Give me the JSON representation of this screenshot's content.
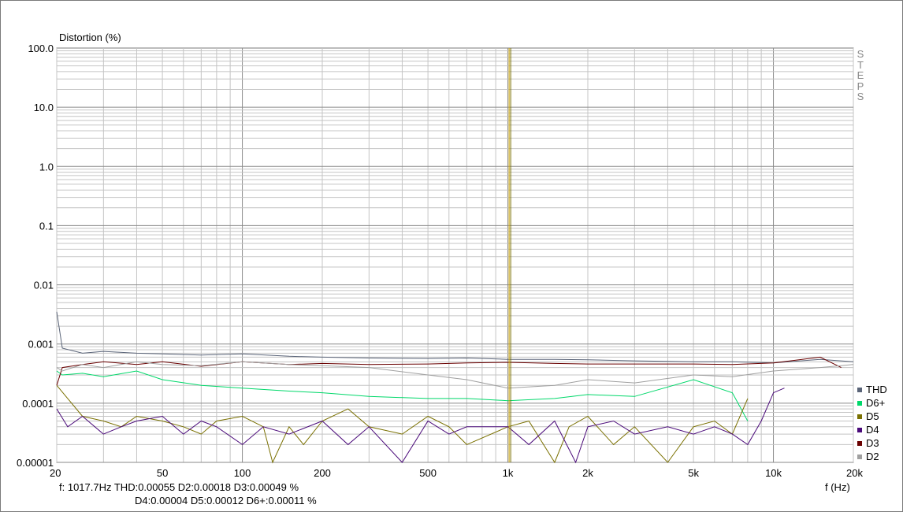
{
  "window": {
    "ylabel": "Distortion (%)",
    "xlabel": "f (Hz)",
    "steps_label": "STEPS"
  },
  "readout": {
    "line1": "f:  1017.7Hz      THD:0.00055   D2:0.00018   D3:0.00049 %",
    "line2": "D4:0.00004   D5:0.00012   D6+:0.00011 %"
  },
  "chart_data": {
    "type": "line",
    "title": "",
    "xlabel": "f (Hz)",
    "ylabel": "Distortion (%)",
    "xscale": "log",
    "yscale": "log",
    "xlim": [
      20,
      20000
    ],
    "ylim": [
      1e-05,
      100
    ],
    "grid": true,
    "legend_position": "bottom-right",
    "marker_frequency": 1017.7,
    "x_ticks": [
      {
        "value": 20,
        "label": "20"
      },
      {
        "value": 50,
        "label": "50"
      },
      {
        "value": 100,
        "label": "100"
      },
      {
        "value": 200,
        "label": "200"
      },
      {
        "value": 500,
        "label": "500"
      },
      {
        "value": 1000,
        "label": "1k"
      },
      {
        "value": 2000,
        "label": "2k"
      },
      {
        "value": 5000,
        "label": "5k"
      },
      {
        "value": 10000,
        "label": "10k"
      },
      {
        "value": 20000,
        "label": "20k"
      }
    ],
    "y_ticks": [
      {
        "value": 100,
        "label": "100.0"
      },
      {
        "value": 10,
        "label": "10.0"
      },
      {
        "value": 1,
        "label": "1.0"
      },
      {
        "value": 0.1,
        "label": "0.1"
      },
      {
        "value": 0.01,
        "label": "0.01"
      },
      {
        "value": 0.001,
        "label": "0.001"
      },
      {
        "value": 0.0001,
        "label": "0.0001"
      },
      {
        "value": 1e-05,
        "label": "0.00001"
      }
    ],
    "series": [
      {
        "name": "THD",
        "color": "#5a6478",
        "x": [
          20,
          21,
          25,
          30,
          40,
          50,
          70,
          100,
          150,
          200,
          300,
          500,
          700,
          1000,
          1500,
          2000,
          3000,
          5000,
          7000,
          10000,
          15000,
          20000
        ],
        "y": [
          0.0035,
          0.00085,
          0.0007,
          0.00075,
          0.0007,
          0.00068,
          0.00065,
          0.00068,
          0.00062,
          0.0006,
          0.00058,
          0.00057,
          0.00058,
          0.00055,
          0.00055,
          0.00054,
          0.00052,
          0.0005,
          0.0005,
          0.00048,
          0.00055,
          0.0005
        ]
      },
      {
        "name": "D6+",
        "color": "#00d86a",
        "x": [
          20,
          21,
          25,
          30,
          40,
          50,
          70,
          100,
          150,
          200,
          300,
          500,
          700,
          1000,
          1500,
          2000,
          3000,
          5000,
          7000,
          8000
        ],
        "y": [
          0.00035,
          0.0003,
          0.00032,
          0.00028,
          0.00035,
          0.00025,
          0.0002,
          0.00018,
          0.00016,
          0.00015,
          0.00013,
          0.00012,
          0.00012,
          0.00011,
          0.00012,
          0.00014,
          0.00013,
          0.00025,
          0.00015,
          5e-05
        ]
      },
      {
        "name": "D5",
        "color": "#7a7000",
        "x": [
          20,
          22,
          25,
          30,
          35,
          40,
          50,
          60,
          70,
          80,
          100,
          120,
          130,
          150,
          170,
          200,
          250,
          300,
          400,
          500,
          600,
          700,
          1000,
          1200,
          1500,
          1700,
          2000,
          2500,
          3000,
          4000,
          5000,
          6000,
          7000,
          8000
        ],
        "y": [
          0.0002,
          0.00012,
          6e-05,
          5e-05,
          4e-05,
          6e-05,
          5e-05,
          4e-05,
          3e-05,
          5e-05,
          6e-05,
          4e-05,
          1e-05,
          4e-05,
          2e-05,
          5e-05,
          8e-05,
          4e-05,
          3e-05,
          6e-05,
          4e-05,
          2e-05,
          4e-05,
          5e-05,
          1e-05,
          4e-05,
          6e-05,
          2e-05,
          4e-05,
          1e-05,
          4e-05,
          5e-05,
          3e-05,
          0.00012
        ]
      },
      {
        "name": "D4",
        "color": "#4a0a7a",
        "x": [
          20,
          22,
          25,
          30,
          35,
          40,
          50,
          60,
          70,
          80,
          100,
          120,
          150,
          200,
          250,
          300,
          400,
          500,
          600,
          700,
          1000,
          1200,
          1500,
          1800,
          2000,
          2500,
          3000,
          4000,
          5000,
          6000,
          7000,
          8000,
          9000,
          10000,
          11000
        ],
        "y": [
          8e-05,
          4e-05,
          6e-05,
          3e-05,
          4e-05,
          5e-05,
          6e-05,
          3e-05,
          5e-05,
          4e-05,
          2e-05,
          4e-05,
          3e-05,
          5e-05,
          2e-05,
          4e-05,
          1e-05,
          5e-05,
          3e-05,
          4e-05,
          4e-05,
          2e-05,
          5e-05,
          1e-05,
          4e-05,
          5e-05,
          3e-05,
          4e-05,
          3e-05,
          4e-05,
          3e-05,
          2e-05,
          5e-05,
          0.00015,
          0.00018
        ]
      },
      {
        "name": "D3",
        "color": "#6a0000",
        "x": [
          20,
          21,
          25,
          30,
          40,
          50,
          70,
          100,
          150,
          200,
          300,
          500,
          700,
          1000,
          1500,
          2000,
          3000,
          5000,
          7000,
          10000,
          15000,
          18000
        ],
        "y": [
          0.0002,
          0.0004,
          0.00045,
          0.0005,
          0.00045,
          0.0005,
          0.00042,
          0.0005,
          0.00045,
          0.00047,
          0.00045,
          0.00046,
          0.00048,
          0.00049,
          0.00047,
          0.00046,
          0.00046,
          0.00046,
          0.00045,
          0.00048,
          0.0006,
          0.0004
        ]
      },
      {
        "name": "D2",
        "color": "#a0a0a0",
        "x": [
          20,
          21,
          25,
          30,
          40,
          50,
          70,
          100,
          150,
          200,
          300,
          500,
          700,
          1000,
          1500,
          2000,
          3000,
          5000,
          7000,
          10000,
          15000,
          20000
        ],
        "y": [
          0.0004,
          0.00035,
          0.00045,
          0.0004,
          0.0005,
          0.00045,
          0.00043,
          0.0005,
          0.00045,
          0.00043,
          0.0004,
          0.0003,
          0.00025,
          0.00018,
          0.0002,
          0.00025,
          0.00022,
          0.0003,
          0.00028,
          0.00035,
          0.0004,
          0.00045
        ]
      }
    ]
  }
}
